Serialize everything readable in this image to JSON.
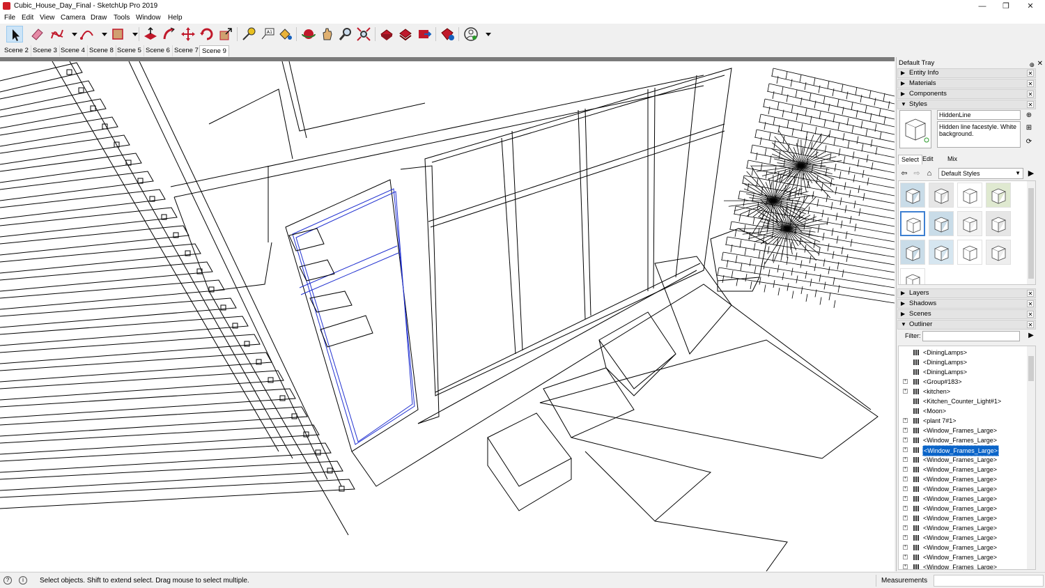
{
  "window": {
    "title": "Cubic_House_Day_Final - SketchUp Pro 2019",
    "minimize": "—",
    "maximize": "❐",
    "close": "✕"
  },
  "menu": [
    "File",
    "Edit",
    "View",
    "Camera",
    "Draw",
    "Tools",
    "Window",
    "Help"
  ],
  "toolbar": {
    "icons": [
      "select-icon",
      "eraser-icon",
      "line-icon",
      "arc-icon",
      "rectangle-icon",
      "push-pull-icon",
      "follow-me-icon",
      "move-icon",
      "rotate-icon",
      "scale-icon",
      "tape-measure-icon",
      "text-icon",
      "paint-bucket-icon",
      "orbit-icon",
      "pan-icon",
      "zoom-icon",
      "zoom-extents-icon",
      "warehouse-icon",
      "extension-warehouse-icon",
      "layout-icon",
      "extension-manager-icon",
      "account-icon"
    ]
  },
  "scenes": [
    "Scene 2",
    "Scene 3",
    "Scene 4",
    "Scene 8",
    "Scene 5",
    "Scene 6",
    "Scene 7",
    "Scene 9"
  ],
  "active_scene": "Scene 9",
  "tray": {
    "title": "Default Tray",
    "pin": "⊕",
    "close": "✕",
    "panels_top": [
      {
        "label": "Entity Info",
        "expanded": false
      },
      {
        "label": "Materials",
        "expanded": false
      },
      {
        "label": "Components",
        "expanded": false
      },
      {
        "label": "Styles",
        "expanded": true
      }
    ],
    "styles": {
      "name": "HiddenLine",
      "description": "Hidden line facestyle. White background.",
      "tabs": [
        "Select",
        "Edit",
        "Mix"
      ],
      "collection": "Default Styles"
    },
    "panels_bottom": [
      {
        "label": "Layers",
        "expanded": false
      },
      {
        "label": "Shadows",
        "expanded": false
      },
      {
        "label": "Scenes",
        "expanded": false
      },
      {
        "label": "Outliner",
        "expanded": true
      }
    ],
    "outliner": {
      "filter_label": "Filter:",
      "filter_value": "",
      "rows": [
        {
          "label": "<DiningLamps>",
          "expandable": false,
          "selected": false
        },
        {
          "label": "<DiningLamps>",
          "expandable": false,
          "selected": false
        },
        {
          "label": "<DiningLamps>",
          "expandable": false,
          "selected": false
        },
        {
          "label": "<Group#183>",
          "expandable": true,
          "selected": false
        },
        {
          "label": "<kitchen>",
          "expandable": true,
          "selected": false
        },
        {
          "label": "<Kitchen_Counter_Light#1>",
          "expandable": false,
          "selected": false
        },
        {
          "label": "<Moon>",
          "expandable": false,
          "selected": false
        },
        {
          "label": "<plant 7#1>",
          "expandable": true,
          "selected": false
        },
        {
          "label": "<Window_Frames_Large>",
          "expandable": true,
          "selected": false
        },
        {
          "label": "<Window_Frames_Large>",
          "expandable": true,
          "selected": false
        },
        {
          "label": "<Window_Frames_Large>",
          "expandable": true,
          "selected": true
        },
        {
          "label": "<Window_Frames_Large>",
          "expandable": true,
          "selected": false
        },
        {
          "label": "<Window_Frames_Large>",
          "expandable": true,
          "selected": false
        },
        {
          "label": "<Window_Frames_Large>",
          "expandable": true,
          "selected": false
        },
        {
          "label": "<Window_Frames_Large>",
          "expandable": true,
          "selected": false
        },
        {
          "label": "<Window_Frames_Large>",
          "expandable": true,
          "selected": false
        },
        {
          "label": "<Window_Frames_Large>",
          "expandable": true,
          "selected": false
        },
        {
          "label": "<Window_Frames_Large>",
          "expandable": true,
          "selected": false
        },
        {
          "label": "<Window_Frames_Large>",
          "expandable": true,
          "selected": false
        },
        {
          "label": "<Window_Frames_Large>",
          "expandable": true,
          "selected": false
        },
        {
          "label": "<Window_Frames_Large>",
          "expandable": true,
          "selected": false
        },
        {
          "label": "<Window_Frames_Large>",
          "expandable": true,
          "selected": false
        },
        {
          "label": "<Window_Frames_Large>",
          "expandable": true,
          "selected": false
        }
      ]
    }
  },
  "status": {
    "message": "Select objects. Shift to extend select. Drag mouse to select multiple.",
    "measurements_label": "Measurements",
    "measurements_value": ""
  }
}
